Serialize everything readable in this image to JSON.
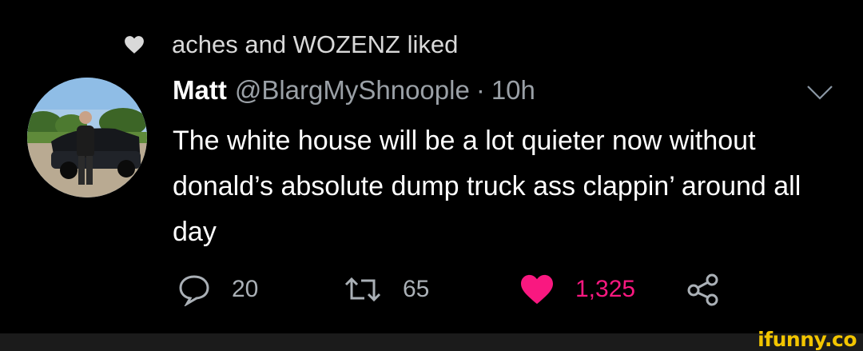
{
  "social_context": {
    "text": "aches and WOZENZ liked",
    "icon": "heart-icon"
  },
  "tweet": {
    "author_name": "Matt",
    "author_handle": "@BlargMyShnoople",
    "separator": "·",
    "time": "10h",
    "text": "The white house will be a lot quieter now without donald’s absolute dump truck ass clappin’ around all day"
  },
  "actions": {
    "reply_count": "20",
    "retweet_count": "65",
    "like_count": "1,325",
    "liked": true
  },
  "colors": {
    "like": "#f91880",
    "background": "#000000",
    "watermark": "#f2c500"
  },
  "watermark": {
    "text": "ifunny.co"
  }
}
